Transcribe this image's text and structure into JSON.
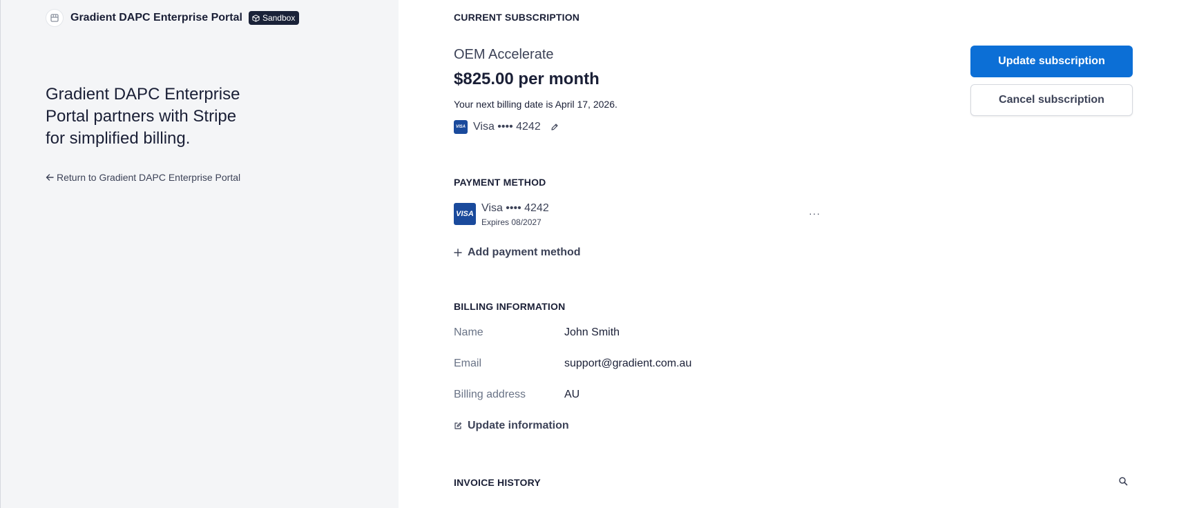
{
  "brand": {
    "name": "Gradient DAPC Enterprise Portal",
    "badge": "Sandbox"
  },
  "left": {
    "tagline": "Gradient DAPC Enterprise Portal partners with Stripe for simplified billing.",
    "return_link": "Return to Gradient DAPC Enterprise Portal"
  },
  "subscription": {
    "section_title": "CURRENT SUBSCRIPTION",
    "plan_name": "OEM Accelerate",
    "price": "$825.00 per month",
    "next_billing": "Your next billing date is April 17, 2026.",
    "card_brand_mark": "VISA",
    "card": "Visa •••• 4242",
    "update_button": "Update subscription",
    "cancel_button": "Cancel subscription"
  },
  "payment": {
    "section_title": "PAYMENT METHOD",
    "card_brand_mark": "VISA",
    "card": "Visa •••• 4242",
    "expires": "Expires 08/2027",
    "more": "···",
    "add_label": "Add payment method"
  },
  "billing": {
    "section_title": "BILLING INFORMATION",
    "rows": [
      {
        "label": "Name",
        "value": "John Smith"
      },
      {
        "label": "Email",
        "value": "support@gradient.com.au"
      },
      {
        "label": "Billing address",
        "value": "AU"
      }
    ],
    "update_label": "Update information"
  },
  "invoices": {
    "section_title": "INVOICE HISTORY"
  },
  "colors": {
    "primary": "#0c6fd6",
    "left_bg": "#f4f5f7",
    "visa": "#1a4a9c",
    "badge_bg": "#1a2238"
  },
  "icons": [
    "store-icon",
    "sandbox-cube-icon",
    "arrow-left-icon",
    "pencil-icon",
    "plus-icon",
    "edit-icon",
    "search-icon"
  ]
}
